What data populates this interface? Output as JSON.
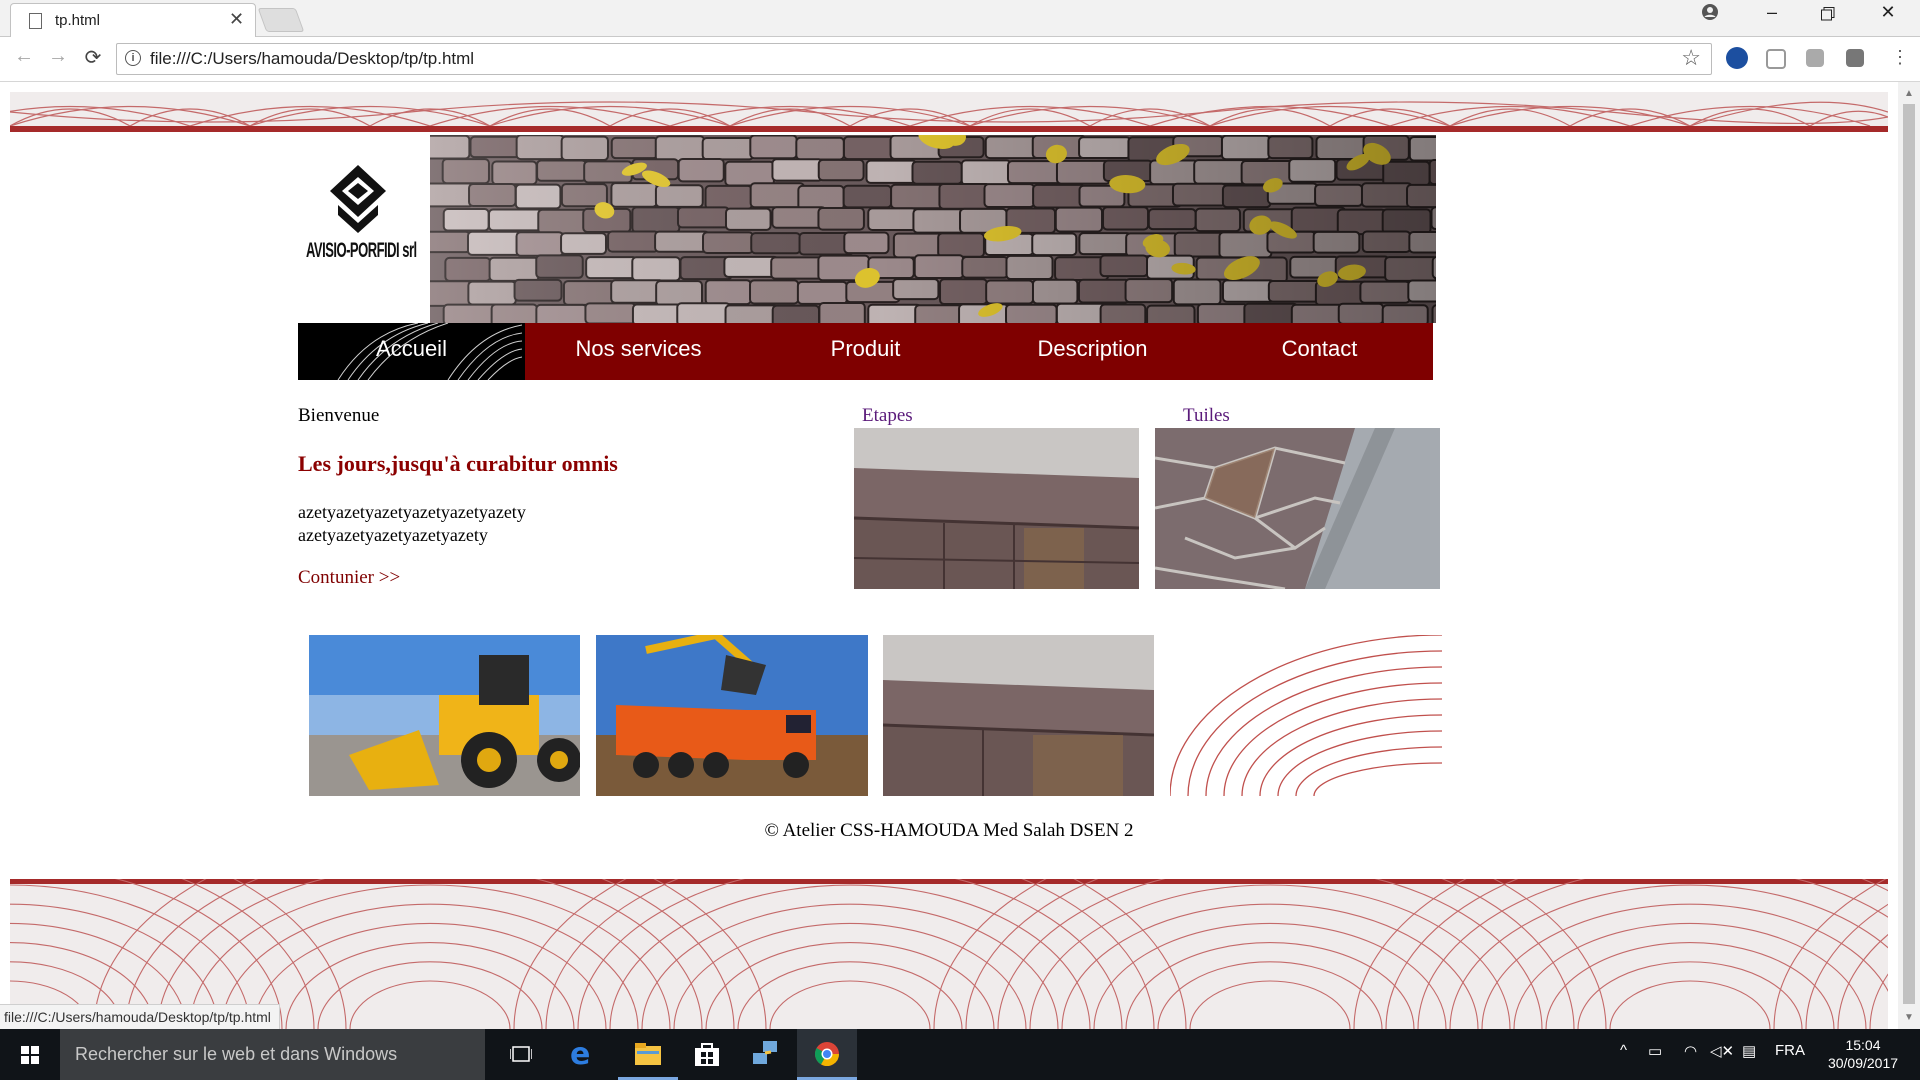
{
  "browser": {
    "tab_title": "tp.html",
    "url": "file:///C:/Users/hamouda/Desktop/tp/tp.html",
    "status_url": "file:///C:/Users/hamouda/Desktop/tp/tp.html",
    "icons": [
      "page-icon",
      "close-icon",
      "profile-icon",
      "minimize-icon",
      "restore-icon",
      "window-close-icon",
      "back-icon",
      "forward-icon",
      "reload-icon",
      "info-icon",
      "bookmark-star-icon",
      "extension-icons",
      "menu-icon"
    ]
  },
  "site": {
    "logo_text": "AVISIO-PORFIDI srl",
    "menu": [
      "Accueil",
      "Nos services",
      "Produit",
      "Description",
      "Contact"
    ],
    "active_menu": "Accueil",
    "welcome": "Bienvenue",
    "headline": "Les jours,jusqu'à curabitur omnis",
    "paragraph_line1": "azetyazetyazetyazetyazetyazety",
    "paragraph_line2": "azetyazetyazetyazetyazety",
    "continue_link": "Contunier >>",
    "caption_1": "Etapes",
    "caption_2": "Tuiles",
    "footer": "© Atelier CSS-HAMOUDA Med Salah DSEN 2",
    "colors": {
      "primary": "#7f0000",
      "active": "#000000",
      "heading": "#8b0000",
      "link": "#5a1a7a",
      "ornament": "#b03a3a"
    }
  },
  "taskbar": {
    "search_placeholder": "Rechercher sur le web et dans Windows",
    "language": "FRA",
    "time": "15:04",
    "date": "30/09/2017"
  }
}
